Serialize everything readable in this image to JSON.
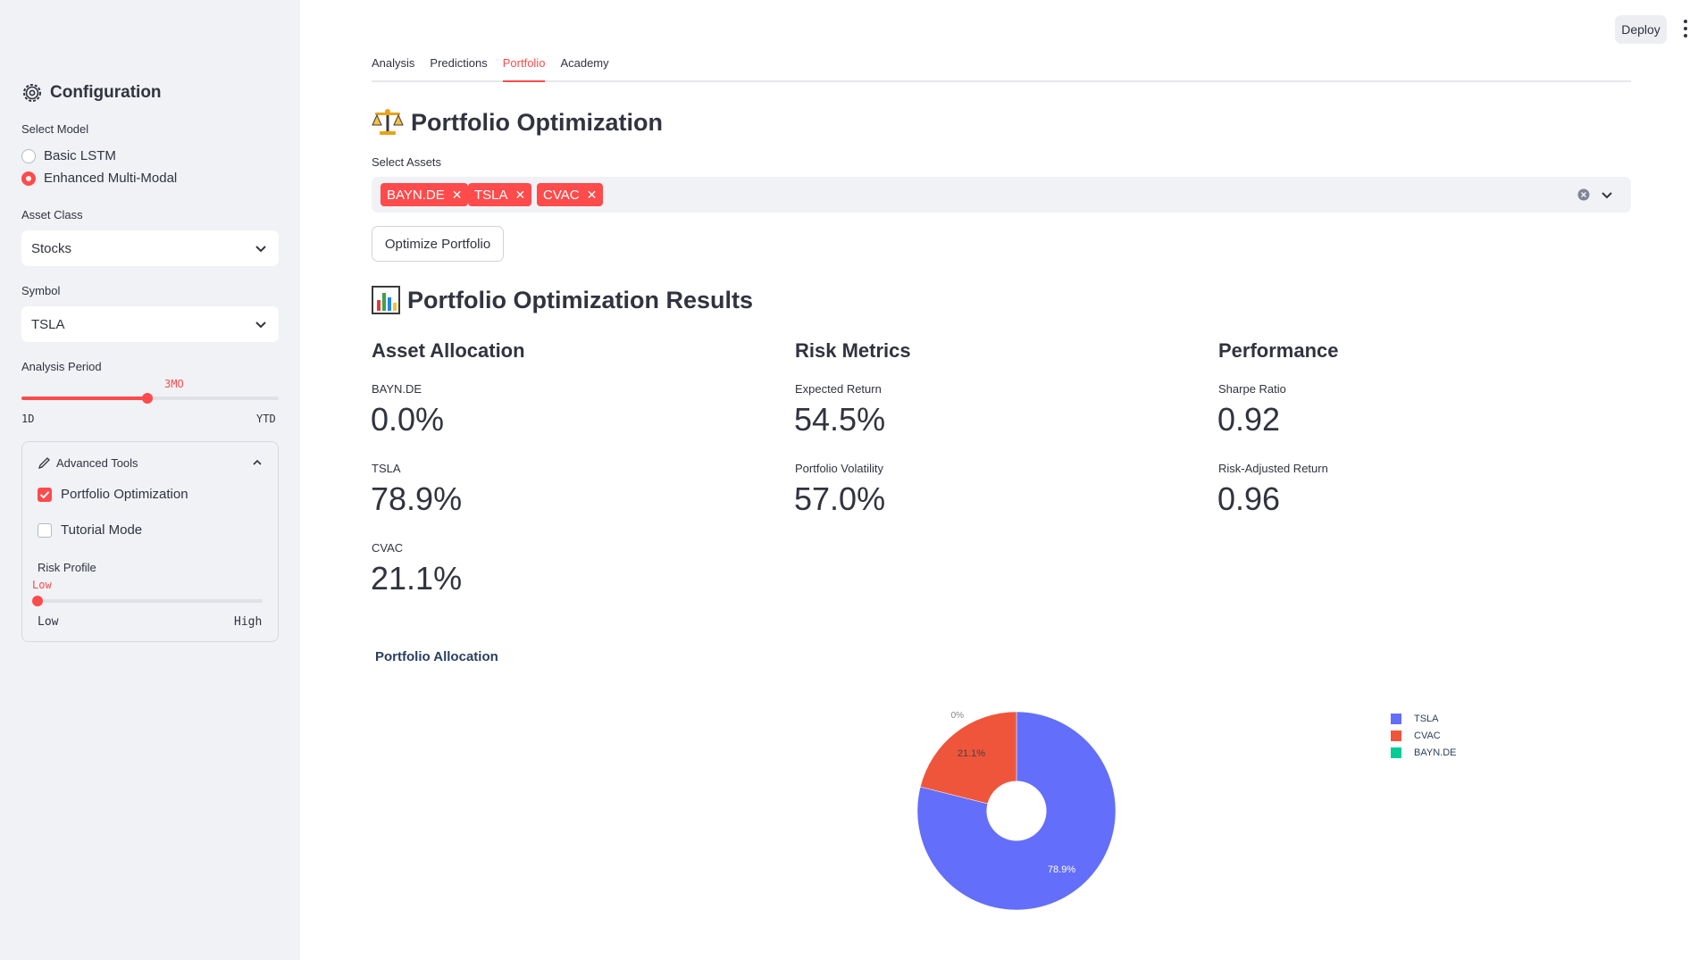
{
  "sidebar": {
    "title": "Configuration",
    "model": {
      "label": "Select Model",
      "options": [
        "Basic LSTM",
        "Enhanced Multi-Modal"
      ],
      "selected": "Enhanced Multi-Modal"
    },
    "asset_class": {
      "label": "Asset Class",
      "value": "Stocks"
    },
    "symbol": {
      "label": "Symbol",
      "value": "TSLA"
    },
    "period": {
      "label": "Analysis Period",
      "value": "3MO",
      "min": "1D",
      "max": "YTD",
      "level": 0.49
    },
    "tools": {
      "title": "Advanced Tools",
      "portfolio_opt": {
        "label": "Portfolio Optimization",
        "checked": true
      },
      "tutorial": {
        "label": "Tutorial Mode",
        "checked": false
      },
      "risk": {
        "label": "Risk Profile",
        "value": "Low",
        "min": "Low",
        "max": "High",
        "level": 0.0
      }
    }
  },
  "header": {
    "deploy_label": "Deploy"
  },
  "tabs": [
    {
      "label": "Analysis"
    },
    {
      "label": "Predictions"
    },
    {
      "label": "Portfolio",
      "active": true
    },
    {
      "label": "Academy"
    }
  ],
  "main": {
    "heading": "Portfolio Optimization",
    "assets_label": "Select Assets",
    "assets": [
      "BAYN.DE",
      "TSLA",
      "CVAC"
    ],
    "optimize_label": "Optimize Portfolio",
    "results_heading": "Portfolio Optimization Results",
    "allocation": {
      "title": "Asset Allocation",
      "items": [
        {
          "label": "BAYN.DE",
          "value": "0.0%"
        },
        {
          "label": "TSLA",
          "value": "78.9%"
        },
        {
          "label": "CVAC",
          "value": "21.1%"
        }
      ]
    },
    "risk": {
      "title": "Risk Metrics",
      "items": [
        {
          "label": "Expected Return",
          "value": "54.5%"
        },
        {
          "label": "Portfolio Volatility",
          "value": "57.0%"
        }
      ]
    },
    "performance": {
      "title": "Performance",
      "items": [
        {
          "label": "Sharpe Ratio",
          "value": "0.92"
        },
        {
          "label": "Risk-Adjusted Return",
          "value": "0.96"
        }
      ]
    }
  },
  "chart_data": {
    "type": "pie",
    "title": "Portfolio Allocation",
    "hole": 0.3,
    "slices": [
      {
        "label": "TSLA",
        "value": 78.9,
        "text": "78.9%",
        "color": "#636efa"
      },
      {
        "label": "CVAC",
        "value": 21.1,
        "text": "21.1%",
        "color": "#ef553b"
      },
      {
        "label": "BAYN.DE",
        "value": 0.0,
        "text": "0%",
        "color": "#00cc96"
      }
    ],
    "legend_position": "top-right"
  },
  "colors": {
    "accent": "#ff4b4b",
    "sidebar_bg": "#f0f2f6"
  }
}
